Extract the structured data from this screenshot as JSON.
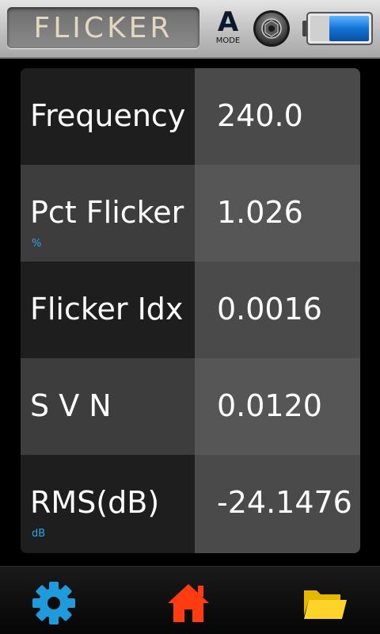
{
  "header": {
    "title": "FLICKER",
    "mode": {
      "letter": "A",
      "label": "MODE"
    },
    "icons": {
      "shutter": "camera-shutter-icon",
      "battery": "battery-icon"
    }
  },
  "rows": [
    {
      "label": "Frequency",
      "unit": "",
      "value": "240.0"
    },
    {
      "label": "Pct Flicker",
      "unit": "%",
      "value": "1.026"
    },
    {
      "label": "Flicker Idx",
      "unit": "",
      "value": "0.0016"
    },
    {
      "label": "S V N",
      "unit": "",
      "value": "0.0120"
    },
    {
      "label": "RMS(dB)",
      "unit": "dB",
      "value": "-24.1476"
    }
  ],
  "nav": {
    "settings_icon": "gear-icon",
    "home_icon": "home-icon",
    "folder_icon": "folder-icon"
  },
  "colors": {
    "title_text": "#e3d7bf",
    "unit_text": "#29a6e8",
    "settings": "#1f9bdc",
    "home": "#ff3b12",
    "folder": "#ffd42a",
    "battery": "#1273d6"
  }
}
